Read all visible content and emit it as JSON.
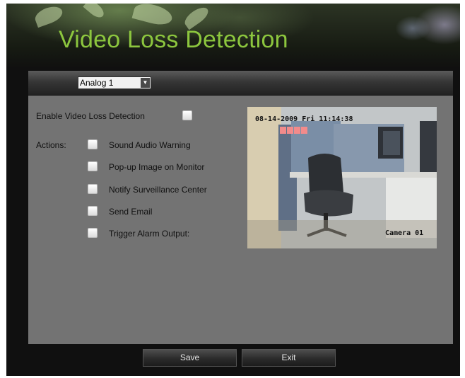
{
  "title": "Video Loss Detection",
  "channel_select": {
    "value": "Analog 1"
  },
  "enable": {
    "label": "Enable Video Loss Detection",
    "checked": false
  },
  "actions_label": "Actions:",
  "actions": [
    {
      "label": "Sound Audio Warning",
      "checked": false
    },
    {
      "label": "Pop-up Image on Monitor",
      "checked": false
    },
    {
      "label": "Notify Surveillance Center",
      "checked": false
    },
    {
      "label": "Send Email",
      "checked": false
    },
    {
      "label": "Trigger Alarm Output:",
      "checked": false
    }
  ],
  "preview": {
    "timestamp": "08-14-2009 Fri 11:14:38",
    "camera": "Camera 01"
  },
  "buttons": {
    "save": "Save",
    "exit": "Exit"
  },
  "colors": {
    "title": "#8cc63e",
    "panel": "#737373",
    "background": "#101010"
  },
  "icons": {
    "dropdown": "chevron-down-icon"
  }
}
